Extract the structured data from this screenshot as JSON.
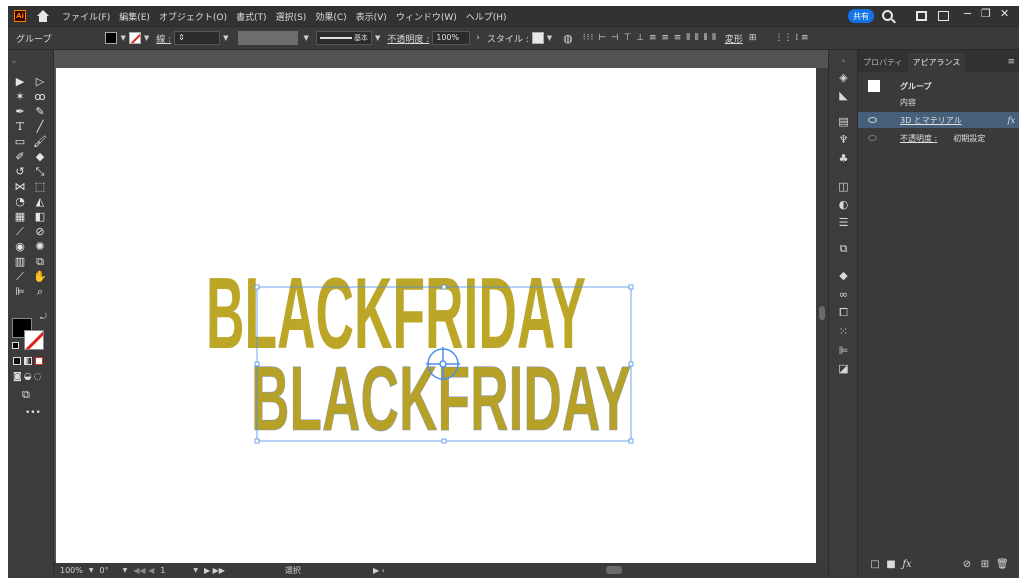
{
  "app": {
    "menus": [
      "ファイル(F)",
      "編集(E)",
      "オブジェクト(O)",
      "書式(T)",
      "選択(S)",
      "効果(C)",
      "表示(V)",
      "ウィンドウ(W)",
      "ヘルプ(H)"
    ],
    "share_label": "共有"
  },
  "control": {
    "selection_type": "グループ",
    "stroke_label": "線 :",
    "brush_label": "基本",
    "opacity_label": "不透明度 :",
    "opacity_value": "100%",
    "style_label": "スタイル :",
    "transform_label": "変形"
  },
  "artwork": {
    "text_top": "BLACKFRIDAY",
    "text_bottom": "BLACKFRIDAY",
    "fill_color": "#c4ad2a"
  },
  "status": {
    "zoom": "100%",
    "rotation": "0°",
    "artboard_number": "1",
    "mode": "選択"
  },
  "panel": {
    "tabs": [
      "プロパティ",
      "アピアランス"
    ],
    "active_tab": "アピアランス",
    "object_name": "グループ",
    "contents_label": "内容",
    "effect_3d": "3D とマテリアル",
    "fx_label": "fx",
    "opacity_label": "不透明度 :",
    "opacity_value": "初期設定"
  },
  "colors": {
    "accent": "#1473e6",
    "selection": "#4a8fe8",
    "stroke_none": "#e2231a"
  }
}
